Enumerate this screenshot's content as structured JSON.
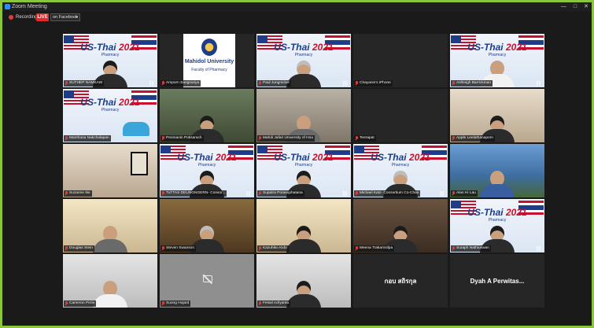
{
  "window": {
    "title": "Zoom Meeting",
    "controls": [
      "—",
      "□",
      "✕"
    ]
  },
  "status": {
    "recording_label": "Recording",
    "live_badge": "LIVE",
    "stream_target": "on Facebook"
  },
  "colors": {
    "accent": "#8cc43c",
    "live": "#e02a2a",
    "mute": "#e03c3c"
  },
  "banner": {
    "logo": "US-Thai",
    "year": "2021",
    "sub": "Pharmacy"
  },
  "mahidol": {
    "title": "Mahidol University",
    "subtitle": "Faculty of Pharmacy"
  },
  "participants": [
    {
      "name": "SUTHEP NAMKAW",
      "scene": "banner",
      "person": "hair"
    },
    {
      "name": "Amporn Sangsuriya",
      "scene": "mahidol"
    },
    {
      "name": "Paul Jungnickel",
      "scene": "banner",
      "person": "gray"
    },
    {
      "name": "Chayanin's iPhone",
      "scene": "dark"
    },
    {
      "name": "Ashleigh Barrickman",
      "scene": "banner",
      "person": "shirt-white"
    },
    {
      "name": "Manthana Nakchalapan",
      "scene": "banner-empty"
    },
    {
      "name": "Penmanin Potisarach",
      "scene": "teal",
      "person": "hair"
    },
    {
      "name": "Mahdi Jafari University of Hou",
      "scene": "office",
      "person": "shirt-gray"
    },
    {
      "name": "Teerapat",
      "scene": "dark"
    },
    {
      "name": "Apple Leelathanaporn",
      "scene": "room",
      "person": "hair"
    },
    {
      "name": "Suzanne Ike",
      "scene": "room-painting"
    },
    {
      "name": "TuTTAS DEUNGNGERN- Consor...",
      "scene": "banner",
      "person": "hair"
    },
    {
      "name": "Supatra Porasuphatana",
      "scene": "banner",
      "person": "hair"
    },
    {
      "name": "Michael Katz- Consortium Co-Chair",
      "scene": "banner",
      "person": "gray"
    },
    {
      "name": "Alan Hi Lau",
      "scene": "city",
      "person": "shirt-blue"
    },
    {
      "name": "Douglas Stein",
      "scene": "cream",
      "person": "shirt-gray"
    },
    {
      "name": "Steven Swanson",
      "scene": "wood",
      "person": "gray"
    },
    {
      "name": "Kazuhiko Kido",
      "scene": "cream",
      "person": "hair"
    },
    {
      "name": "Meena Trakarnsilpa",
      "scene": "shelf",
      "person": "hair"
    },
    {
      "name": "Suraph Nathiuswan",
      "scene": "banner",
      "person": "hair"
    },
    {
      "name": "Cameron Pirrie",
      "scene": "light",
      "person": "shirt-white"
    },
    {
      "name": "Suong Hujard",
      "scene": "cam-off"
    },
    {
      "name": "Feisal Adryanta",
      "scene": "light",
      "person": "hair"
    },
    {
      "name": "กอบ สถิรกุล",
      "scene": "name-only"
    },
    {
      "name": "Dyah A Perwitas...",
      "scene": "name-only"
    }
  ]
}
